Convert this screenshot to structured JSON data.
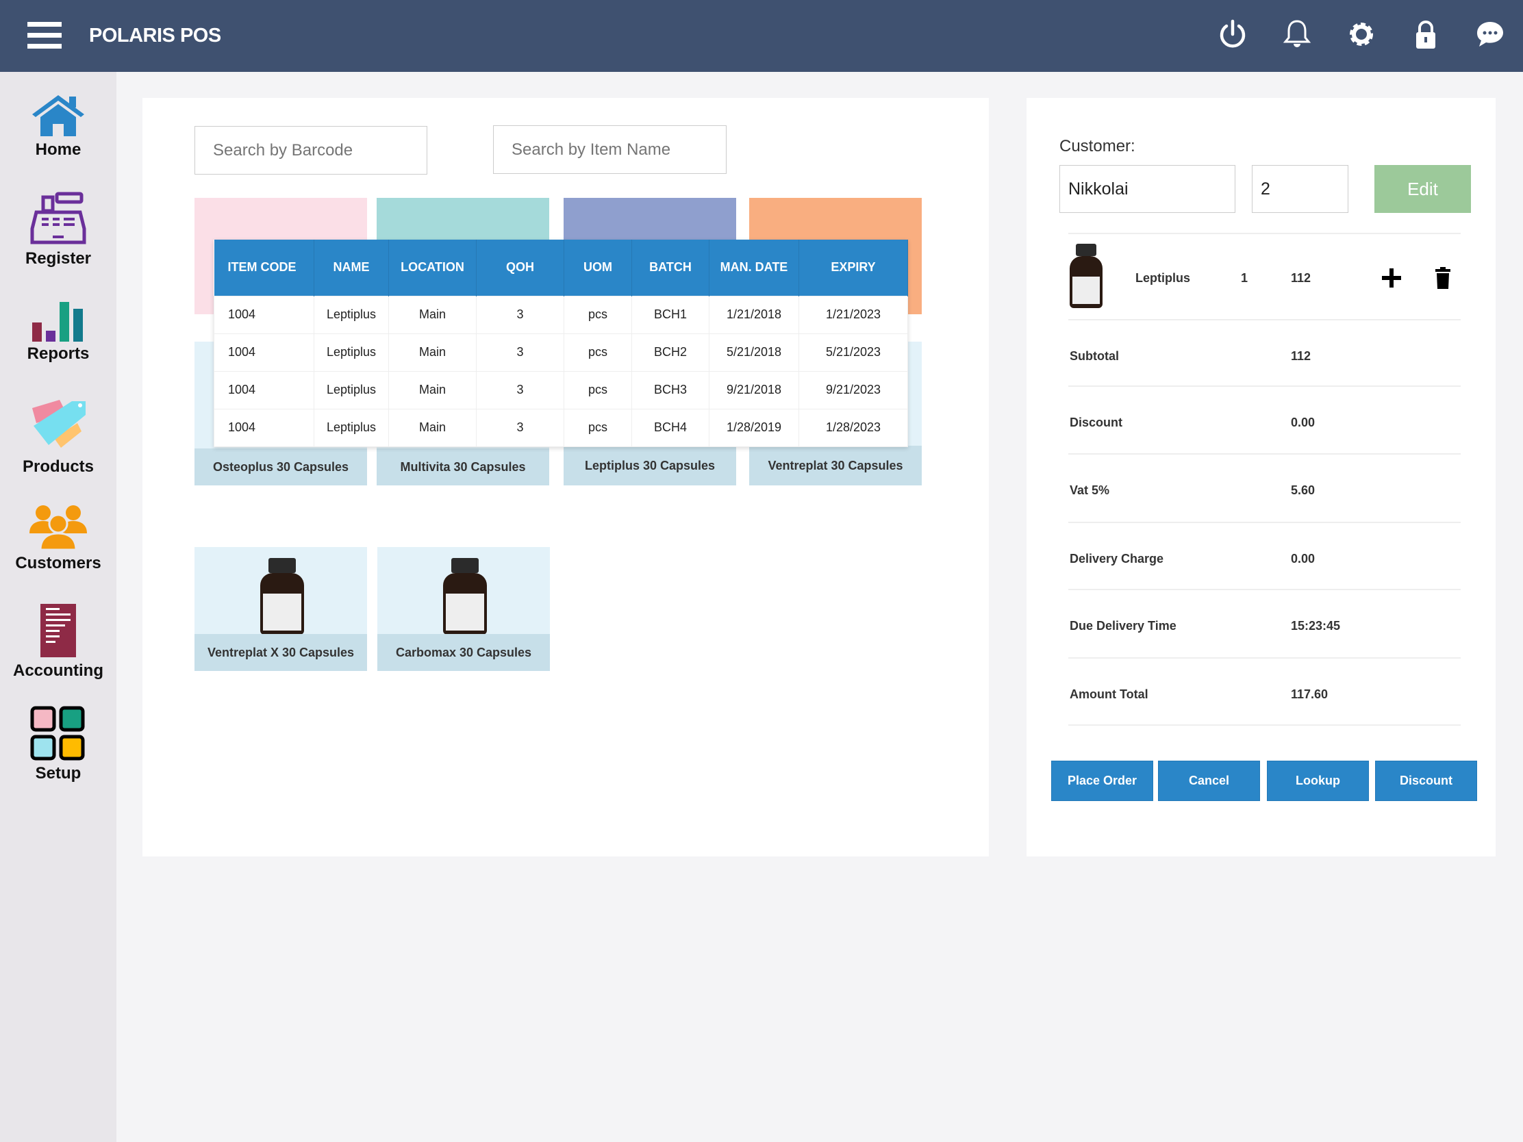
{
  "header": {
    "title": "POLARIS POS",
    "icons": [
      "power-icon",
      "bell-icon",
      "gear-icon",
      "lock-icon",
      "chat-icon"
    ]
  },
  "sidebar": {
    "items": [
      {
        "label": "Home",
        "icon": "home-icon"
      },
      {
        "label": "Register",
        "icon": "cash-register-icon"
      },
      {
        "label": "Reports",
        "icon": "bar-chart-icon"
      },
      {
        "label": "Products",
        "icon": "tags-icon"
      },
      {
        "label": "Customers",
        "icon": "users-icon"
      },
      {
        "label": "Accounting",
        "icon": "receipt-icon"
      },
      {
        "label": "Setup",
        "icon": "grid-icon"
      }
    ]
  },
  "search": {
    "barcode_placeholder": "Search by Barcode",
    "name_placeholder": "Search by Item Name"
  },
  "tiles": [
    {
      "label": "Osteoplus 30 Capsules",
      "color": "#fbdfe7"
    },
    {
      "label": "Multivita 30 Capsules",
      "color": "#a5dada"
    },
    {
      "label": "Leptiplus 30 Capsules",
      "color": "#8f9fce"
    },
    {
      "label": "Ventreplat 30 Capsules",
      "color": "#f9ae80"
    },
    {
      "label": "Ventreplat X 30 Capsules",
      "color": "#e3f2f9"
    },
    {
      "label": "Carbomax 30 Capsules",
      "color": "#e3f2f9"
    }
  ],
  "table": {
    "headers": [
      "ITEM CODE",
      "NAME",
      "LOCATION",
      "QOH",
      "UOM",
      "BATCH",
      "MAN. DATE",
      "EXPIRY"
    ],
    "rows": [
      [
        "1004",
        "Leptiplus",
        "Main",
        "3",
        "pcs",
        "BCH1",
        "1/21/2018",
        "1/21/2023"
      ],
      [
        "1004",
        "Leptiplus",
        "Main",
        "3",
        "pcs",
        "BCH2",
        "5/21/2018",
        "5/21/2023"
      ],
      [
        "1004",
        "Leptiplus",
        "Main",
        "3",
        "pcs",
        "BCH3",
        "9/21/2018",
        "9/21/2023"
      ],
      [
        "1004",
        "Leptiplus",
        "Main",
        "3",
        "pcs",
        "BCH4",
        "1/28/2019",
        "1/28/2023"
      ]
    ]
  },
  "customer": {
    "label": "Customer:",
    "name": "Nikkolai",
    "number": "2",
    "edit_label": "Edit"
  },
  "cart": {
    "item": {
      "name": "Leptiplus",
      "qty": "1",
      "price": "112"
    }
  },
  "summary": [
    {
      "label": "Subtotal",
      "value": "112"
    },
    {
      "label": "Discount",
      "value": "0.00"
    },
    {
      "label": "Vat 5%",
      "value": "5.60"
    },
    {
      "label": "Delivery Charge",
      "value": "0.00"
    },
    {
      "label": "Due Delivery Time",
      "value": "15:23:45"
    },
    {
      "label": "Amount Total",
      "value": "117.60"
    }
  ],
  "actions": {
    "place_order": "Place Order",
    "cancel": "Cancel",
    "lookup": "Lookup",
    "discount": "Discount"
  }
}
